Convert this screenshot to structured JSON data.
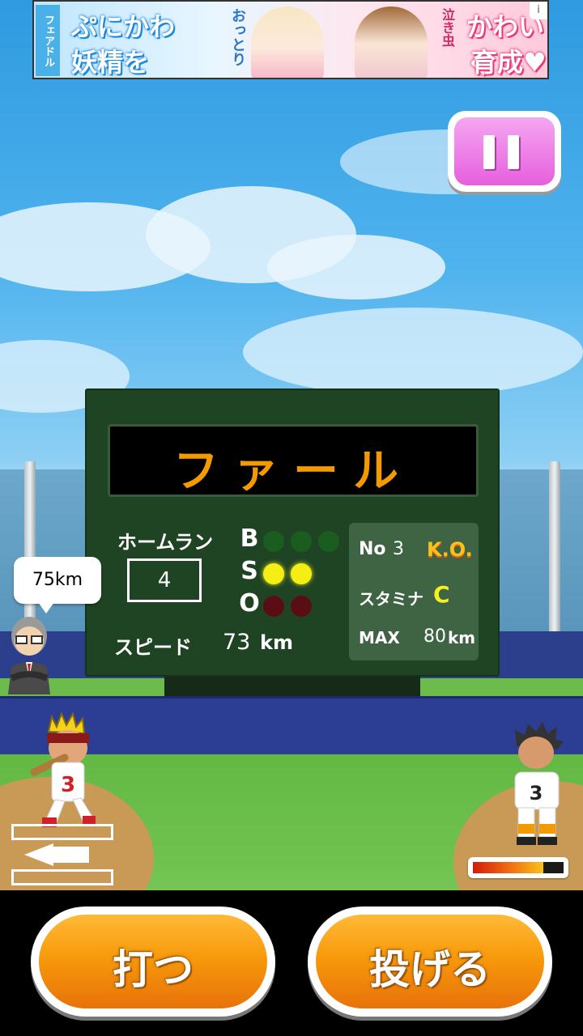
{
  "ad": {
    "vertical_text": "フェアドル",
    "line1": "ぷにかわ",
    "line2": "妖精を",
    "tag1": "おっとり",
    "tag2": "泣き虫",
    "line3": "かわいく",
    "line4": "育成♥",
    "info_icon": "i"
  },
  "scoreboard": {
    "call": "ファール",
    "homerun_label": "ホームラン",
    "homerun_count": "4",
    "speed_label": "スピード",
    "speed_value": "73",
    "speed_unit": "km",
    "count": {
      "ball_label": "B",
      "strike_label": "S",
      "out_label": "O",
      "balls": 0,
      "balls_max": 3,
      "strikes": 2,
      "strikes_max": 2,
      "outs": 0,
      "outs_max": 2
    },
    "info": {
      "no_label": "No",
      "no_value": "3",
      "status": "K.O.",
      "stamina_label": "スタミナ",
      "stamina_grade": "C",
      "max_label": "MAX",
      "max_value": "80",
      "max_unit": "km"
    }
  },
  "coach_bubble": "75km",
  "batter_number": "3",
  "pitcher_number": "3",
  "stamina_gauge_level": 0.78,
  "buttons": {
    "hit": "打つ",
    "pitch": "投げる"
  },
  "colors": {
    "display_text": "#f29a00",
    "strike_lamp": "#f4ee14",
    "ball_lamp": "#1a5d1f",
    "out_lamp": "#5a0d14",
    "pause_button": "#e65fdd",
    "action_button": "#f79a0b"
  },
  "icons": {
    "pause": "pause-icon",
    "zone_arrow": "left-arrow-icon"
  }
}
